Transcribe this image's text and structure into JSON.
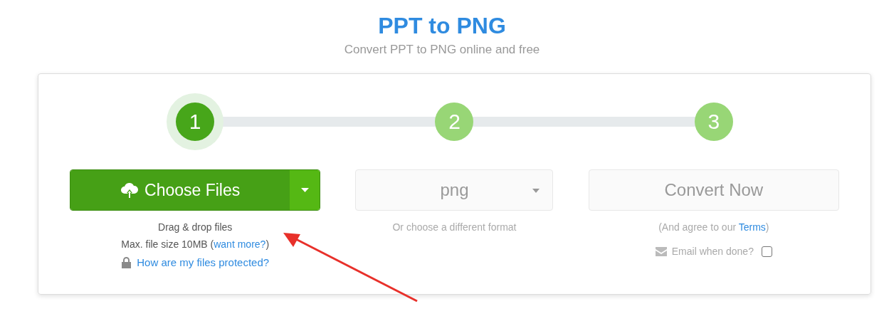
{
  "title": "PPT to PNG",
  "subtitle": "Convert PPT to PNG online and free",
  "steps": [
    {
      "number": "1",
      "active": true
    },
    {
      "number": "2",
      "active": false
    },
    {
      "number": "3",
      "active": false
    }
  ],
  "choose_button": {
    "label": "Choose Files"
  },
  "upload_notes": {
    "line_1": "Drag & drop files",
    "line_2_start": "Max. file size 10MB (",
    "link": "want more?",
    "line_2_end": ")",
    "protection_link": "How are my files protected?"
  },
  "format_select": {
    "value": "png",
    "hint": "Or choose a different format"
  },
  "convert_button": {
    "label": "Convert Now",
    "disabled": true
  },
  "terms": {
    "text_before": "(And agree to our ",
    "link": "Terms",
    "text_after": ")"
  },
  "email_option": {
    "label": "Email when done?",
    "checked": false
  }
}
